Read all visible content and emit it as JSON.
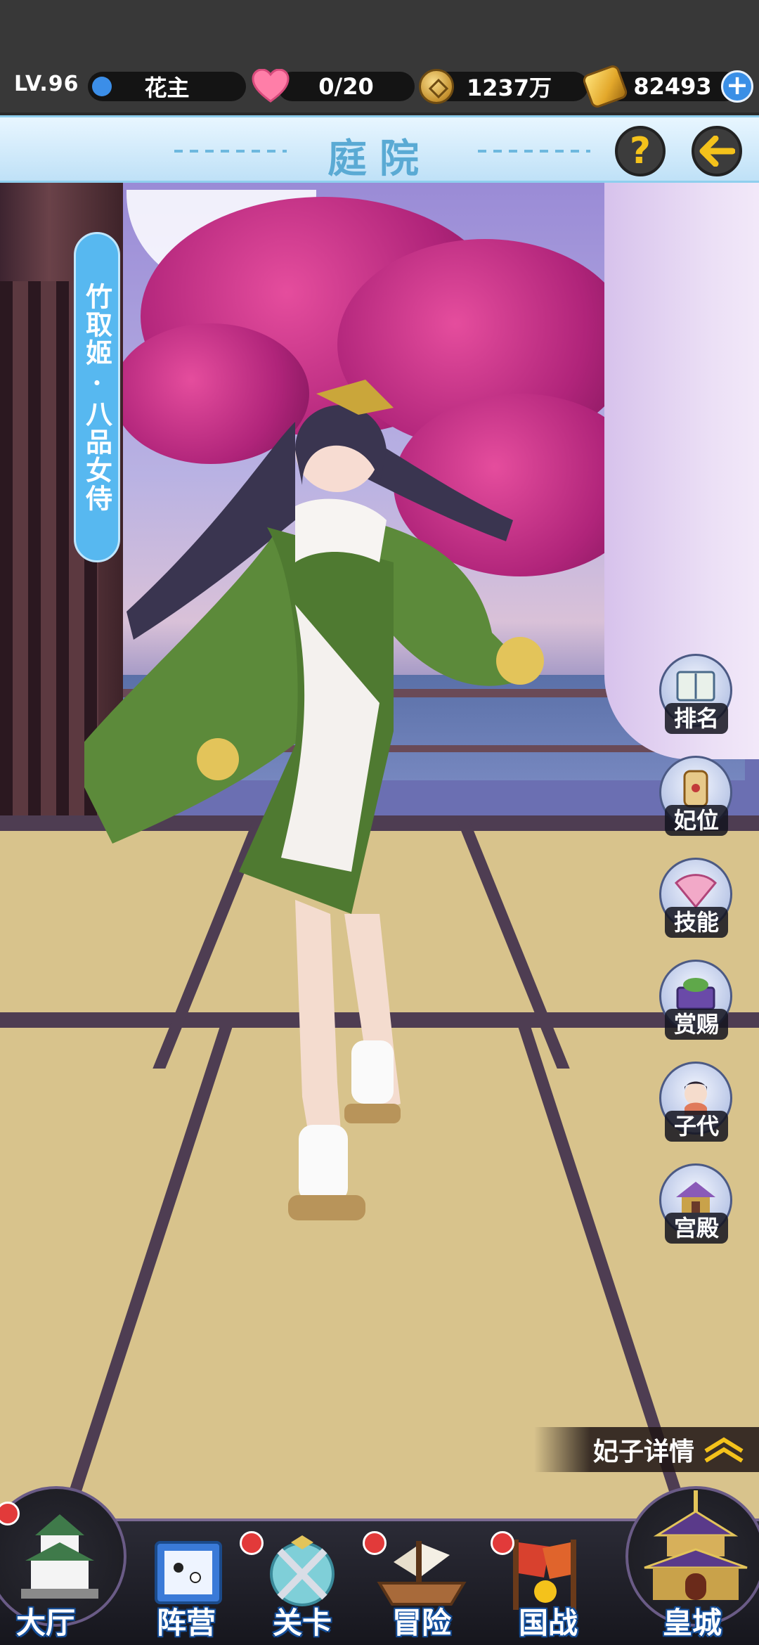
{
  "status": {
    "level": "LV.96",
    "rank": "花主",
    "hearts": "0/20",
    "coins": "1237万",
    "gold": "82493",
    "plus": "+"
  },
  "header": {
    "title": "庭院",
    "help": "?"
  },
  "character": {
    "name": "竹取姬·八品女侍"
  },
  "side_menu": [
    {
      "label": "排名",
      "icon": "book-icon"
    },
    {
      "label": "妃位",
      "icon": "scroll-icon"
    },
    {
      "label": "技能",
      "icon": "fan-icon"
    },
    {
      "label": "赏赐",
      "icon": "gift-box-icon"
    },
    {
      "label": "子代",
      "icon": "child-avatar-icon"
    },
    {
      "label": "宫殿",
      "icon": "palace-icon"
    }
  ],
  "details_label": "妃子详情",
  "bottom_nav": [
    {
      "label": "大厅",
      "icon": "castle-icon"
    },
    {
      "label": "阵营",
      "icon": "go-board-scroll-icon"
    },
    {
      "label": "关卡",
      "icon": "crossed-swords-icon"
    },
    {
      "label": "冒险",
      "icon": "ship-icon"
    },
    {
      "label": "国战",
      "icon": "war-banner-icon"
    },
    {
      "label": "皇城",
      "icon": "imperial-palace-icon"
    }
  ],
  "colors": {
    "accent_blue": "#57b8f0",
    "title_blue": "#5aaad4",
    "gold": "#f4c21b",
    "badge_red": "#e23a3a"
  }
}
